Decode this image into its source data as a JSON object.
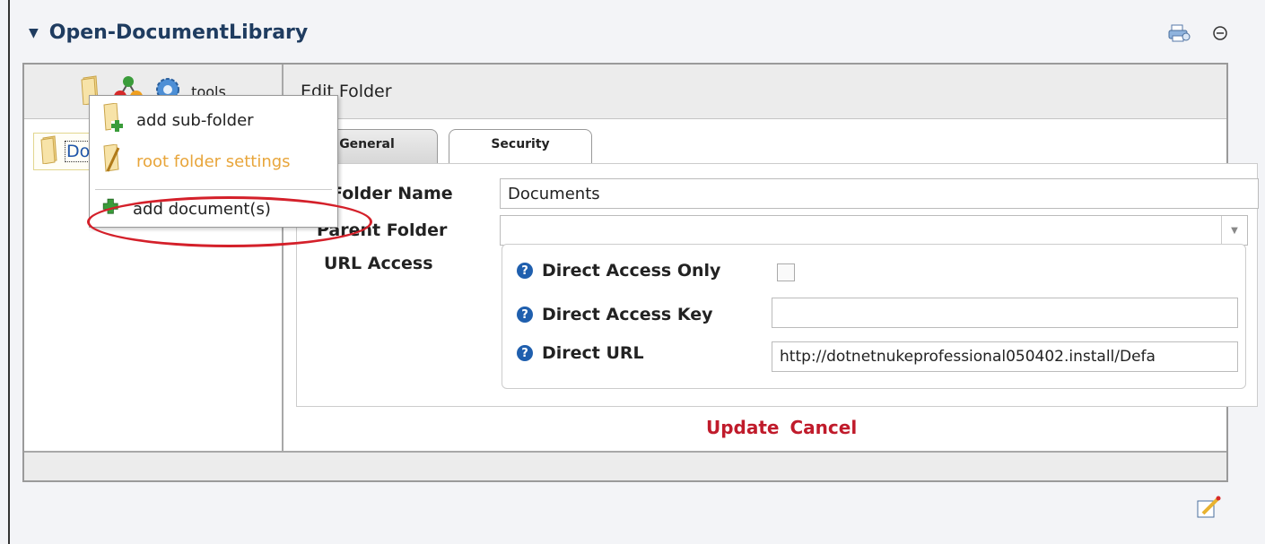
{
  "module": {
    "title": "Open-DocumentLibrary",
    "collapse_icon": "triangle-down-icon",
    "right_icons": [
      "print-icon",
      "minimize-icon"
    ]
  },
  "toolbar": {
    "icons": [
      "folder-icon",
      "module-structure-icon",
      "gear-icon"
    ],
    "tools_label": "tools",
    "edit_title": "Edit Folder"
  },
  "tree": {
    "root_label": "Documents"
  },
  "context_menu": {
    "items": [
      {
        "label": "add sub-folder",
        "icon": "folder-add-icon"
      },
      {
        "label": "root folder settings",
        "icon": "folder-settings-icon"
      },
      {
        "label": "add document(s)",
        "icon": "add-document-icon"
      }
    ]
  },
  "tabs": [
    {
      "label": "General"
    },
    {
      "label": "Security"
    }
  ],
  "form": {
    "folder_name_label": "Folder Name",
    "folder_name_value": "Documents",
    "parent_folder_label": "Parent Folder",
    "parent_folder_value": "",
    "url_access_label": "URL Access",
    "direct_access_only_label": "Direct Access Only",
    "direct_access_key_label": "Direct Access Key",
    "direct_access_key_value": "",
    "direct_url_label": "Direct URL",
    "direct_url_value": "http://dotnetnukeprofessional050402.install/Defa"
  },
  "actions": {
    "update": "Update",
    "cancel": "Cancel"
  },
  "colors": {
    "title": "#1f3c60",
    "action_red": "#c01b2b",
    "highlight": "#e8a53a",
    "annotation": "#d4202a"
  }
}
